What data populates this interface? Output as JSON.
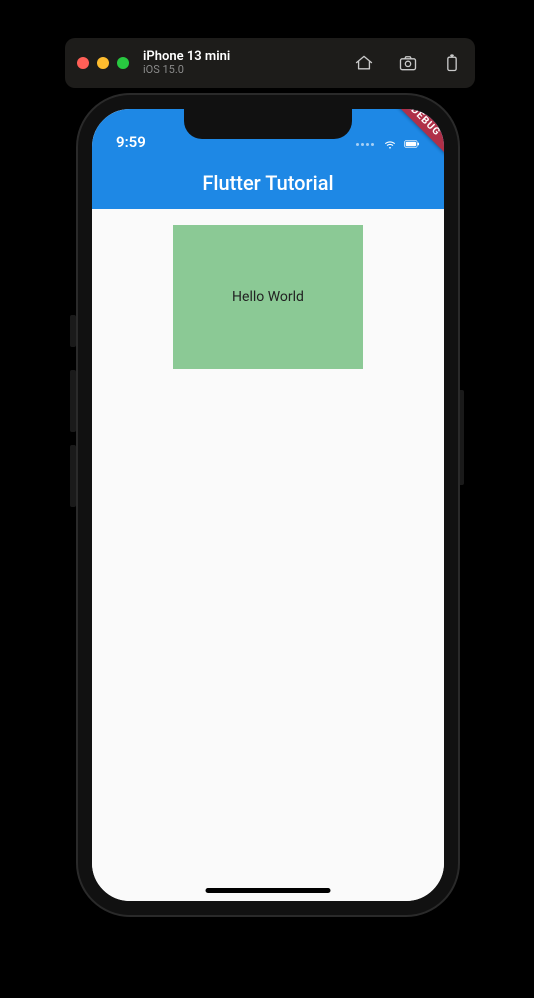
{
  "simulator": {
    "device_name": "iPhone 13 mini",
    "os_version": "iOS 15.0"
  },
  "status_bar": {
    "time": "9:59"
  },
  "app_bar": {
    "title": "Flutter Tutorial"
  },
  "content": {
    "box_text": "Hello World"
  },
  "debug_banner": {
    "label": "DEBUG"
  },
  "colors": {
    "app_bar_bg": "#1e88e5",
    "box_bg": "#8bc995",
    "banner_bg": "#b03048"
  }
}
